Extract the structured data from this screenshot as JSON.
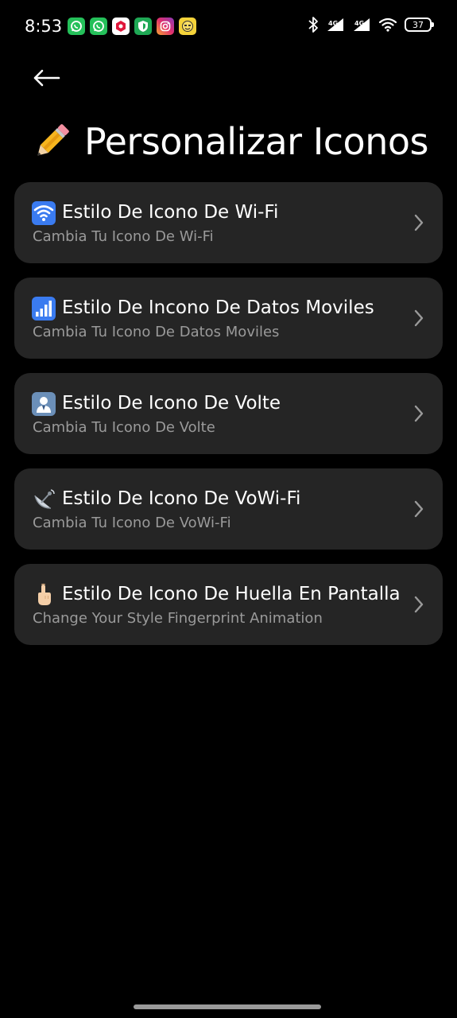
{
  "status_bar": {
    "time": "8:53",
    "battery_level": "37",
    "notification_icons": [
      "whatsapp-icon",
      "whatsapp-icon",
      "app-hexagon-icon",
      "shield-vpn-icon",
      "instagram-icon",
      "emoji-app-icon"
    ],
    "system_icons": [
      "bluetooth-icon",
      "signal-icon",
      "signal-icon",
      "wifi-icon",
      "battery-icon"
    ]
  },
  "header": {
    "back_icon": "arrow-left-icon",
    "title_icon": "pencil-icon",
    "title": "Personalizar Iconos"
  },
  "items": [
    {
      "icon": "wifi-icon",
      "title": "Estilo De Icono De Wi-Fi",
      "subtitle": "Cambia Tu Icono De Wi-Fi"
    },
    {
      "icon": "signal-bars-icon",
      "title": "Estilo De Incono De Datos Moviles",
      "subtitle": "Cambia Tu Icono De Datos Moviles"
    },
    {
      "icon": "volte-icon",
      "title": "Estilo De Icono De Volte",
      "subtitle": "Cambia Tu Icono De Volte"
    },
    {
      "icon": "satellite-dish-icon",
      "title": "Estilo De Icono De VoWi-Fi",
      "subtitle": "Cambia Tu Icono De VoWi-Fi"
    },
    {
      "icon": "pointing-finger-icon",
      "title": "Estilo De Icono De Huella En Pantalla",
      "subtitle": "Change Your Style Fingerprint Animation"
    }
  ],
  "colors": {
    "background": "#000000",
    "card": "#252525",
    "title_text": "#ffffff",
    "subtitle_text": "#9a9a9a",
    "chevron": "#9a9a9a"
  }
}
